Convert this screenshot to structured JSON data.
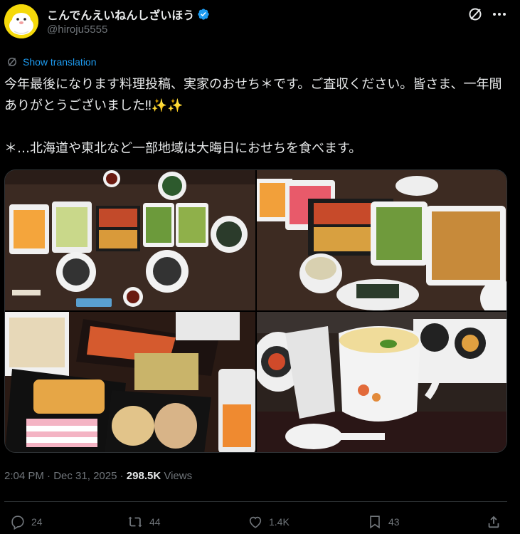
{
  "author": {
    "display_name": "こんでんえいねんしざいほう",
    "handle": "@hiroju5555",
    "avatar_icon": "seal-avatar-icon",
    "verified_icon": "verified-badge-icon"
  },
  "translate_label": "Show translation",
  "tweet_text": "今年最後になります料理投稿、実家のおせち＊です。ご査収ください。皆さま、一年間ありがとうございました‼✨✨\n\n＊…北海道や東北など一部地域は大晦日におせちを食べます。",
  "meta": {
    "time": "2:04 PM",
    "separator": " · ",
    "date": "Dec 31, 2025",
    "views_count": "298.5K",
    "views_label": "Views"
  },
  "actions": {
    "replies": "24",
    "reposts": "44",
    "likes": "1.4K",
    "bookmarks": "43"
  },
  "colors": {
    "background": "#000000",
    "text": "#e7e9ea",
    "muted": "#71767b",
    "accent": "#1d9bf0",
    "avatar": "#f5d90a"
  }
}
